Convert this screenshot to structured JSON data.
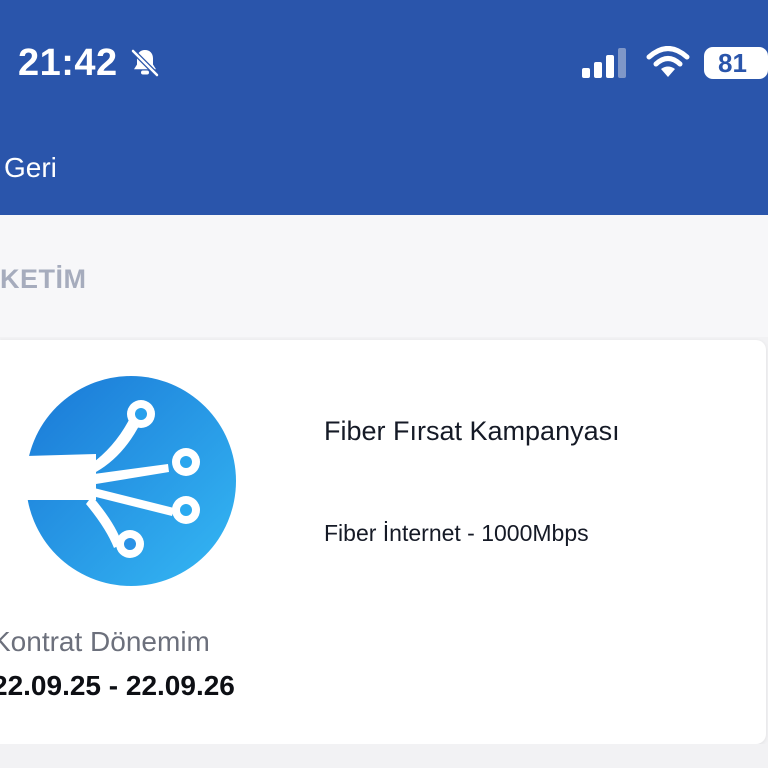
{
  "status_bar": {
    "time": "21:42",
    "battery": "81",
    "icons": [
      "bell-slash-icon",
      "cellular-signal-icon",
      "wifi-icon",
      "battery-icon"
    ]
  },
  "nav": {
    "back_label": "Geri"
  },
  "section": {
    "title": "KETİM"
  },
  "package": {
    "name": "Fiber Fırsat Kampanyası",
    "detail": "Fiber İnternet - 1000Mbps",
    "contract_label": "Kontrat Dönemim",
    "contract_dates": "22.09.25 - 22.09.26",
    "icon": "fiber-optic-icon"
  },
  "colors": {
    "header": "#2a55ab",
    "logo_blue": "#1e88e5",
    "section_text": "#a6acbd",
    "muted_text": "#6c707c"
  }
}
